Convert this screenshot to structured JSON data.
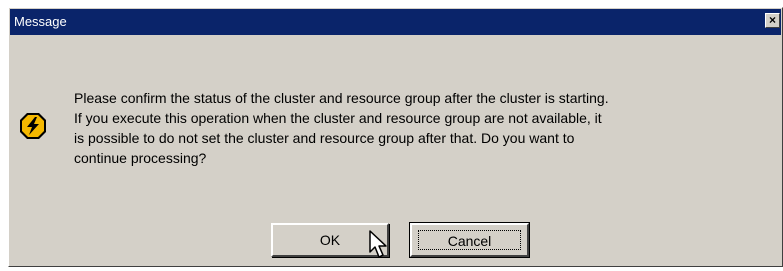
{
  "window": {
    "title": "Message",
    "close_glyph": "×"
  },
  "icon": "warning-lightning-icon",
  "message": {
    "lines": [
      "Please confirm the status of the cluster and resource group after the cluster is starting.",
      " If you execute this operation when the cluster and resource group are not available, it",
      "is possible to do not set the cluster and resource group after that. Do you want to",
      "continue processing?"
    ]
  },
  "buttons": {
    "ok_label": "OK",
    "cancel_label": "Cancel"
  },
  "colors": {
    "titlebar": "#0a246a",
    "dialog_face": "#d4d0c8",
    "icon_fill": "#f5b800"
  }
}
